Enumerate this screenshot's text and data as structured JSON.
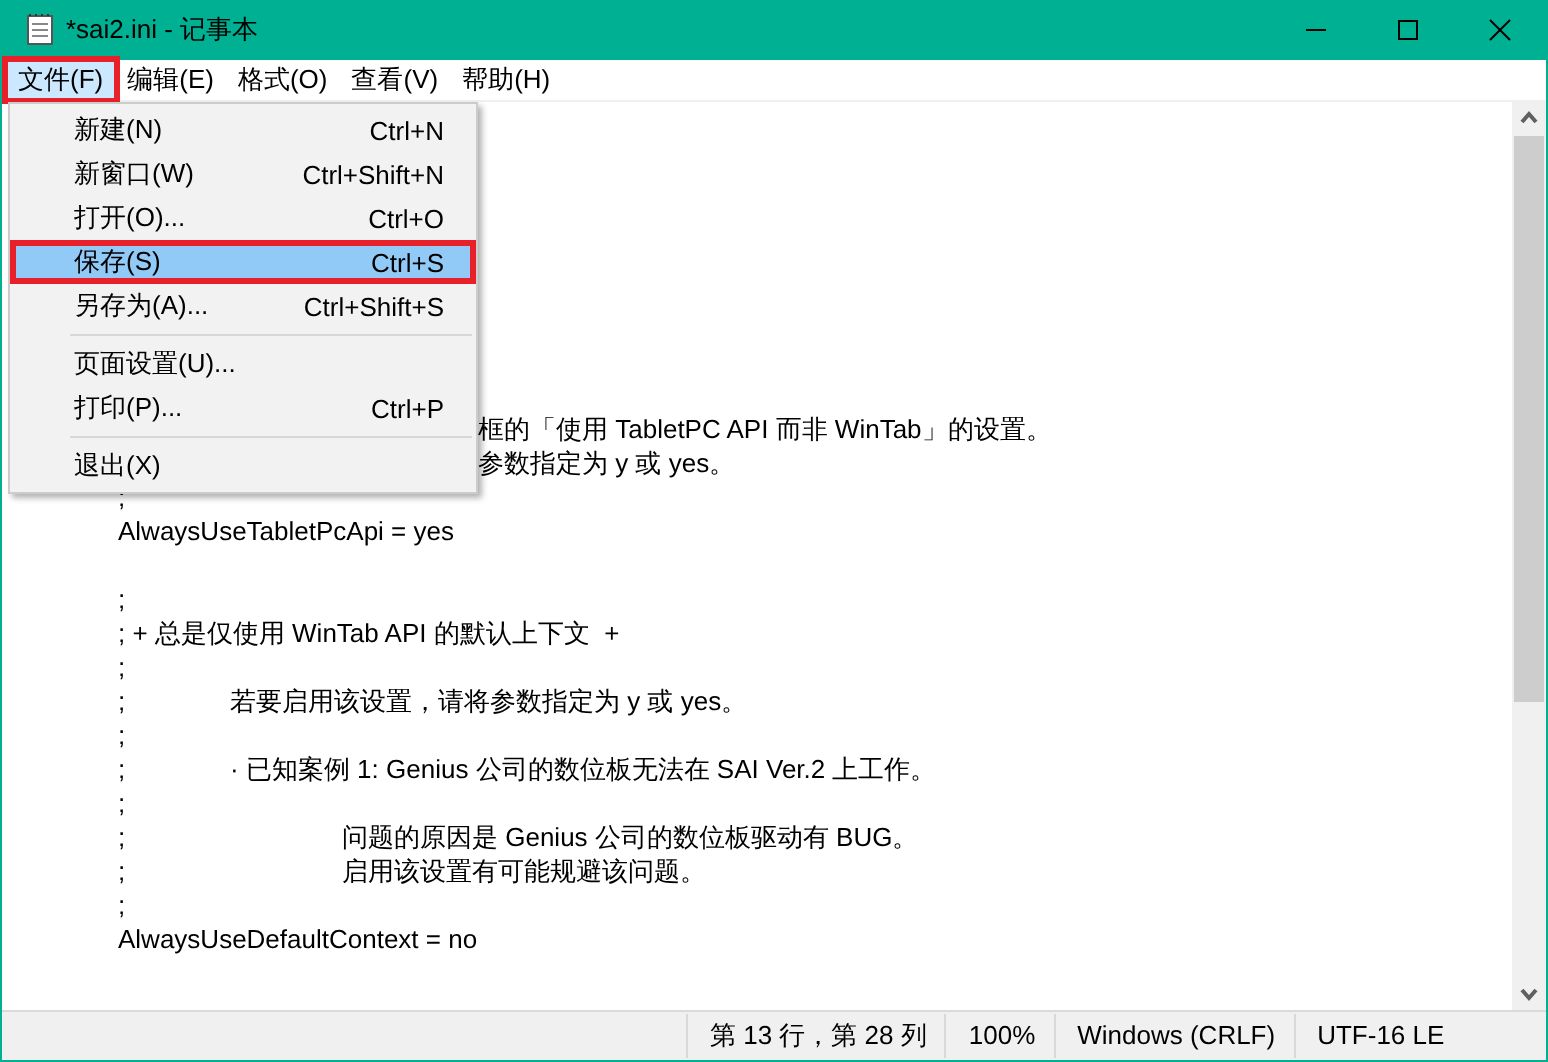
{
  "window": {
    "title": "*sai2.ini - 记事本"
  },
  "menu_bar": [
    {
      "label": "文件(F)",
      "selected": true,
      "outlined": true
    },
    {
      "label": "编辑(E)",
      "selected": false,
      "outlined": false
    },
    {
      "label": "格式(O)",
      "selected": false,
      "outlined": false
    },
    {
      "label": "查看(V)",
      "selected": false,
      "outlined": false
    },
    {
      "label": "帮助(H)",
      "selected": false,
      "outlined": false
    }
  ],
  "file_menu": [
    {
      "kind": "item",
      "label": "新建(N)",
      "shortcut": "Ctrl+N",
      "selected": false,
      "outlined": false
    },
    {
      "kind": "item",
      "label": "新窗口(W)",
      "shortcut": "Ctrl+Shift+N",
      "selected": false,
      "outlined": false
    },
    {
      "kind": "item",
      "label": "打开(O)...",
      "shortcut": "Ctrl+O",
      "selected": false,
      "outlined": false
    },
    {
      "kind": "item",
      "label": "保存(S)",
      "shortcut": "Ctrl+S",
      "selected": true,
      "outlined": true
    },
    {
      "kind": "item",
      "label": "另存为(A)...",
      "shortcut": "Ctrl+Shift+S",
      "selected": false,
      "outlined": false
    },
    {
      "kind": "separator"
    },
    {
      "kind": "item",
      "label": "页面设置(U)...",
      "selected": false,
      "outlined": false
    },
    {
      "kind": "item",
      "label": "打印(P)...",
      "shortcut": "Ctrl+P",
      "selected": false,
      "outlined": false
    },
    {
      "kind": "separator"
    },
    {
      "kind": "item",
      "label": "退出(X)",
      "selected": false,
      "outlined": false
    }
  ],
  "editor_lines": [
    {
      "kind": "clipped",
      "text": "框的「使用 TabletPC API 而非 WinTab」的设置。"
    },
    {
      "kind": "clipped",
      "text": "参数指定为 y 或 yes。"
    },
    {
      "kind": "text",
      "text": ";"
    },
    {
      "kind": "text",
      "text": "AlwaysUseTabletPcApi = yes"
    },
    {
      "kind": "blank"
    },
    {
      "kind": "text",
      "text": ";"
    },
    {
      "kind": "text",
      "text": "; + 总是仅使用 WinTab API 的默认上下文  +"
    },
    {
      "kind": "text",
      "text": ";"
    },
    {
      "kind": "text",
      "text": ";\t若要启用该设置，请将参数指定为 y 或 yes。"
    },
    {
      "kind": "text",
      "text": ";"
    },
    {
      "kind": "text",
      "text": ";\t· 已知案例 1: Genius 公司的数位板无法在 SAI Ver.2 上工作。"
    },
    {
      "kind": "text",
      "text": ";"
    },
    {
      "kind": "text",
      "text": ";\t\t问题的原因是 Genius 公司的数位板驱动有 BUG。"
    },
    {
      "kind": "text",
      "text": ";\t\t启用该设置有可能规避该问题。"
    },
    {
      "kind": "text",
      "text": ";"
    },
    {
      "kind": "text",
      "text": "AlwaysUseDefaultContext = no"
    }
  ],
  "status_bar": [
    "第 13 行，第 28 列",
    "100%",
    "Windows (CRLF)",
    "UTF-16 LE"
  ]
}
